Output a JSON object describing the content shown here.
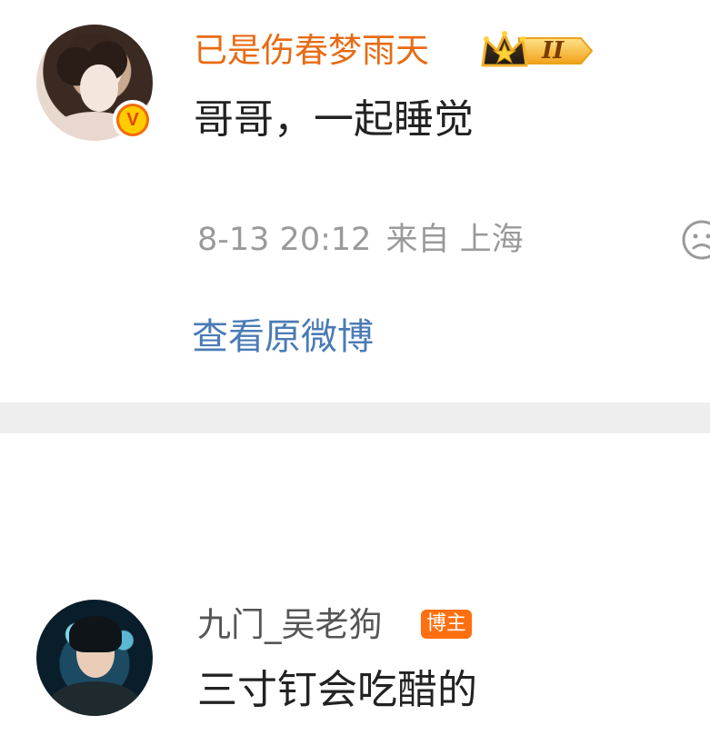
{
  "comments": [
    {
      "username": "已是伤春梦雨天",
      "verified_mark": "V",
      "vip_level": "II",
      "text": "哥哥，一起睡觉",
      "time": "8-13 20:12",
      "source": "来自 上海",
      "view_original": "查看原微博",
      "icons": {
        "verified": "verified-badge-icon",
        "vip": "vip-crown-icon",
        "reaction": "sad-face-icon"
      },
      "colors": {
        "username": "#e86b14",
        "link": "#4a7bb6"
      }
    },
    {
      "username": "九门_吴老狗",
      "badge": "博主",
      "text": "三寸钉会吃醋的",
      "colors": {
        "badge_bg": "#ff6f0f"
      }
    }
  ]
}
